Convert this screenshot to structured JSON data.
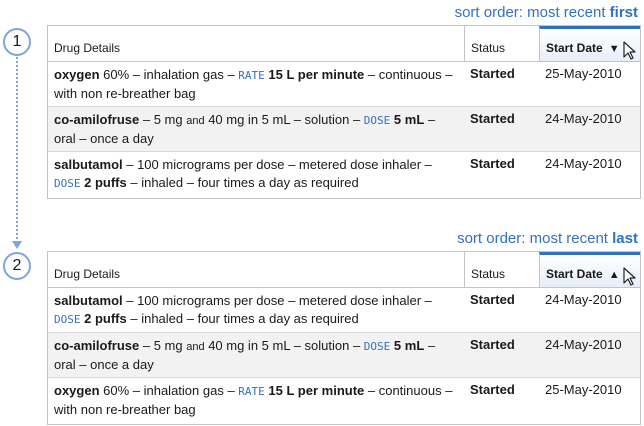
{
  "steps": [
    "1",
    "2"
  ],
  "tables": [
    {
      "sort_prefix": "sort order: most recent ",
      "sort_emphasis": "first",
      "headers": {
        "drug": "Drug Details",
        "status": "Status",
        "date": "Start Date",
        "sort_indicator": "▼"
      },
      "rows": [
        {
          "name": "oxygen",
          "parts": [
            " 60% – inhalation gas – "
          ],
          "kw": "RATE",
          "value": "15 L per minute",
          "tail": " – continuous – with non re-breather bag",
          "status": "Started",
          "date": "25-May-2010"
        },
        {
          "name": "co-amilofruse",
          "parts": [
            " – 5 mg ",
            "and",
            " 40 mg in 5 mL – solution – "
          ],
          "kw": "DOSE",
          "value": "5 mL",
          "tail": " – oral – once a day",
          "status": "Started",
          "date": "24-May-2010"
        },
        {
          "name": "salbutamol",
          "parts": [
            " – 100 micrograms per dose – metered dose inhaler – "
          ],
          "kw": "DOSE",
          "value": "2 puffs",
          "tail": " – inhaled – four times a day as required",
          "status": "Started",
          "date": "24-May-2010"
        }
      ]
    },
    {
      "sort_prefix": "sort order: most recent ",
      "sort_emphasis": "last",
      "headers": {
        "drug": "Drug Details",
        "status": "Status",
        "date": "Start Date",
        "sort_indicator": "▲"
      },
      "rows": [
        {
          "name": "salbutamol",
          "parts": [
            " – 100 micrograms per dose – metered dose inhaler – "
          ],
          "kw": "DOSE",
          "value": "2 puffs",
          "tail": " – inhaled – four times a day as required",
          "status": "Started",
          "date": "24-May-2010"
        },
        {
          "name": "co-amilofruse",
          "parts": [
            " – 5 mg ",
            "and",
            " 40 mg in 5 mL – solution – "
          ],
          "kw": "DOSE",
          "value": "5 mL",
          "tail": " – oral – once a day",
          "status": "Started",
          "date": "24-May-2010"
        },
        {
          "name": "oxygen",
          "parts": [
            " 60% – inhalation gas – "
          ],
          "kw": "RATE",
          "value": "15 L per minute",
          "tail": " – continuous – with non re-breather bag",
          "status": "Started",
          "date": "25-May-2010"
        }
      ]
    }
  ],
  "icons": {
    "cursor": "mouse-pointer-icon"
  },
  "colors": {
    "accent": "#2f72c4",
    "step_ring": "#7fa6dc",
    "row_alt": "#f2f2f2"
  }
}
